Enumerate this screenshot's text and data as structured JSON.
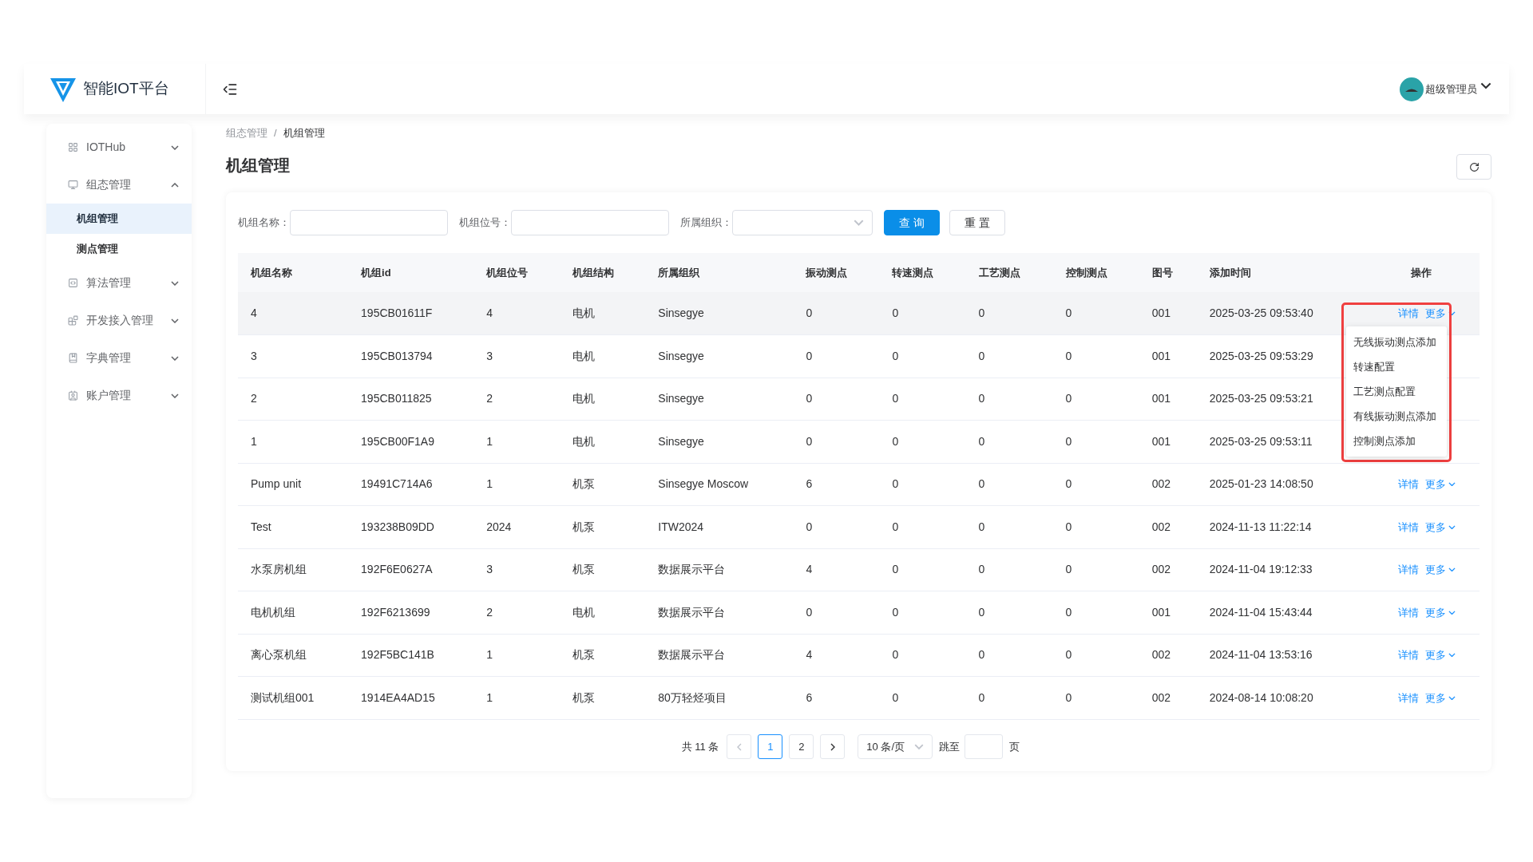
{
  "header": {
    "logo_text": "智能IOT平台",
    "user_name": "超级管理员"
  },
  "sidebar": {
    "items": [
      {
        "label": "IOTHub",
        "expanded": false
      },
      {
        "label": "组态管理",
        "expanded": true,
        "children": [
          {
            "label": "机组管理",
            "selected": true
          },
          {
            "label": "测点管理",
            "selected": false
          }
        ]
      },
      {
        "label": "算法管理",
        "expanded": false
      },
      {
        "label": "开发接入管理",
        "expanded": false
      },
      {
        "label": "字典管理",
        "expanded": false
      },
      {
        "label": "账户管理",
        "expanded": false
      }
    ]
  },
  "breadcrumb": [
    "组态管理",
    "机组管理"
  ],
  "breadcrumb_separator": "/",
  "page_title": "机组管理",
  "filters": [
    {
      "kind": "input",
      "label": "机组名称："
    },
    {
      "kind": "input",
      "label": "机组位号："
    },
    {
      "kind": "select",
      "label": "所属组织："
    }
  ],
  "buttons": [
    {
      "kind": "primary",
      "label": "查 询"
    },
    {
      "kind": "default",
      "label": "重 置"
    }
  ],
  "table": {
    "columns": [
      "机组名称",
      "机组id",
      "机组位号",
      "机组结构",
      "所属组织",
      "振动测点",
      "转速测点",
      "工艺测点",
      "控制测点",
      "图号",
      "添加时间",
      "操作"
    ],
    "rows": [
      {
        "hovered": true,
        "cells": [
          "4",
          "195CB01611F",
          "4",
          "电机",
          "Sinsegye",
          "0",
          "0",
          "0",
          "0",
          "001",
          "2025-03-25 09:53:40"
        ],
        "actions": [
          "详情",
          "更多"
        ]
      },
      {
        "hovered": false,
        "cells": [
          "3",
          "195CB013794",
          "3",
          "电机",
          "Sinsegye",
          "0",
          "0",
          "0",
          "0",
          "001",
          "2025-03-25 09:53:29"
        ]
      },
      {
        "hovered": false,
        "cells": [
          "2",
          "195CB011825",
          "2",
          "电机",
          "Sinsegye",
          "0",
          "0",
          "0",
          "0",
          "001",
          "2025-03-25 09:53:21"
        ]
      },
      {
        "hovered": false,
        "cells": [
          "1",
          "195CB00F1A9",
          "1",
          "电机",
          "Sinsegye",
          "0",
          "0",
          "0",
          "0",
          "001",
          "2025-03-25 09:53:11"
        ]
      },
      {
        "hovered": false,
        "cells": [
          "Pump unit",
          "19491C714A6",
          "1",
          "机泵",
          "Sinsegye Moscow",
          "6",
          "0",
          "0",
          "0",
          "002",
          "2025-01-23 14:08:50"
        ],
        "actions": [
          "详情",
          "更多"
        ]
      },
      {
        "hovered": false,
        "cells": [
          "Test",
          "193238B09DD",
          "2024",
          "机泵",
          "ITW2024",
          "0",
          "0",
          "0",
          "0",
          "002",
          "2024-11-13 11:22:14"
        ],
        "actions": [
          "详情",
          "更多"
        ]
      },
      {
        "hovered": false,
        "cells": [
          "水泵房机组",
          "192F6E0627A",
          "3",
          "机泵",
          "数据展示平台",
          "4",
          "0",
          "0",
          "0",
          "002",
          "2024-11-04 19:12:33"
        ],
        "actions": [
          "详情",
          "更多"
        ]
      },
      {
        "hovered": false,
        "cells": [
          "电机机组",
          "192F6213699",
          "2",
          "电机",
          "数据展示平台",
          "0",
          "0",
          "0",
          "0",
          "001",
          "2024-11-04 15:43:44"
        ],
        "actions": [
          "详情",
          "更多"
        ]
      },
      {
        "hovered": false,
        "cells": [
          "离心泵机组",
          "192F5BC141B",
          "1",
          "机泵",
          "数据展示平台",
          "4",
          "0",
          "0",
          "0",
          "002",
          "2024-11-04 13:53:16"
        ],
        "actions": [
          "详情",
          "更多"
        ]
      },
      {
        "hovered": false,
        "cells": [
          "测试机组001",
          "1914EA4AD15",
          "1",
          "机泵",
          "80万轻烃项目",
          "6",
          "0",
          "0",
          "0",
          "002",
          "2024-08-14 10:08:20"
        ],
        "actions": [
          "详情",
          "更多"
        ]
      }
    ]
  },
  "dropdown_menu": {
    "items": [
      "无线振动测点添加",
      "转速配置",
      "工艺测点配置",
      "有线振动测点添加",
      "控制测点添加"
    ]
  },
  "pagination": {
    "total": "共 11 条",
    "prev_disabled": true,
    "pages": [
      {
        "label": "1",
        "selected": true
      },
      {
        "label": "2",
        "selected": false
      }
    ],
    "page_size": "10 条/页",
    "jump_label": "跳至",
    "page_unit": "页"
  }
}
